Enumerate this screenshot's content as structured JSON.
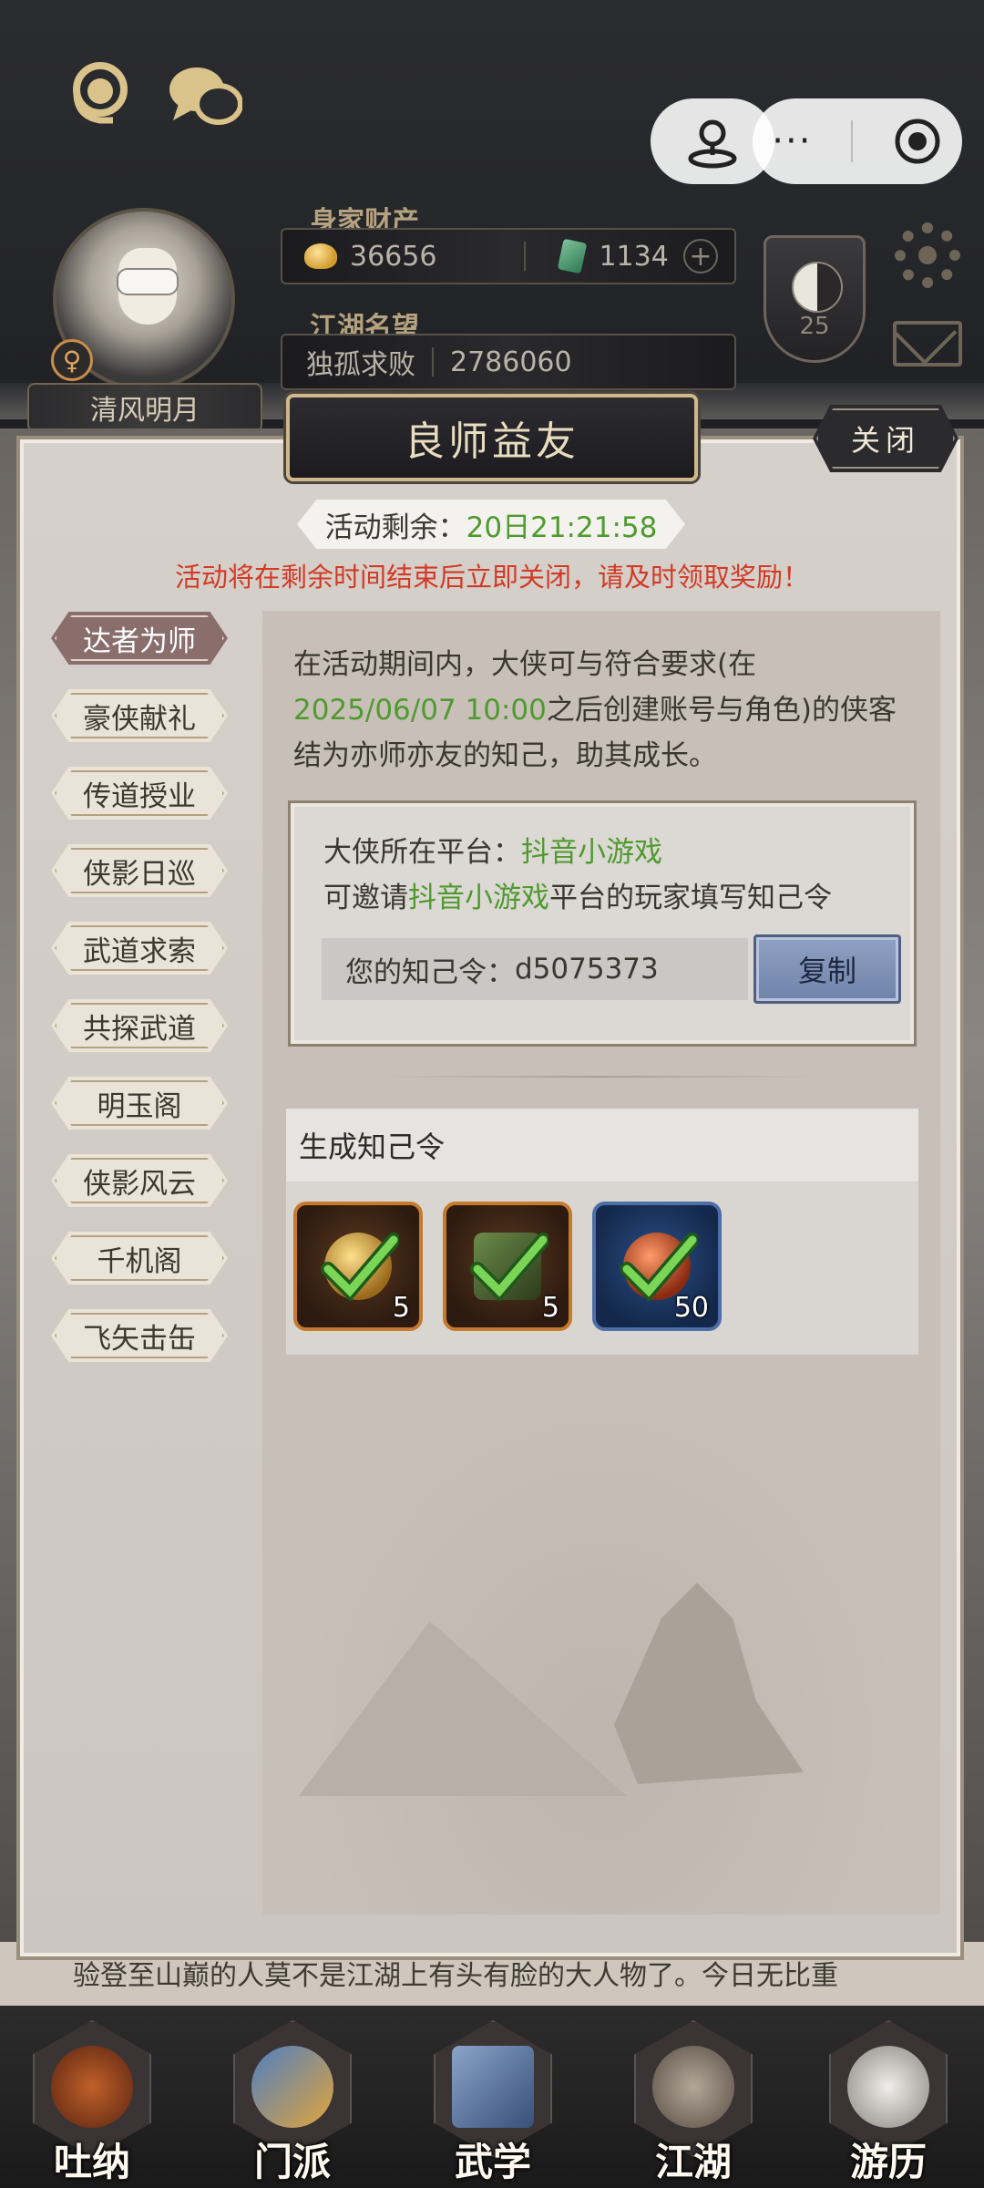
{
  "header": {
    "player_name": "清风明月",
    "gender_symbol": "♀",
    "wealth_label": "身家财产",
    "gold_value": "36656",
    "jade_value": "1134",
    "plus_symbol": "+",
    "fame_label": "江湖名望",
    "fame_title": "独孤求败",
    "fame_value": "2786060",
    "level": "25",
    "more_symbol": "···"
  },
  "modal": {
    "title": "良师益友",
    "close_label": "关闭",
    "timer_label": "活动剩余：",
    "timer_value": "20日21:21:58",
    "warning": "活动将在剩余时间结束后立即关闭，请及时领取奖励！",
    "tabs": [
      {
        "label": "达者为师",
        "active": true
      },
      {
        "label": "豪侠献礼",
        "active": false
      },
      {
        "label": "传道授业",
        "active": false
      },
      {
        "label": "侠影日巡",
        "active": false
      },
      {
        "label": "武道求索",
        "active": false
      },
      {
        "label": "共探武道",
        "active": false
      },
      {
        "label": "明玉阁",
        "active": false
      },
      {
        "label": "侠影风云",
        "active": false
      },
      {
        "label": "千机阁",
        "active": false
      },
      {
        "label": "飞矢击缶",
        "active": false
      }
    ],
    "description": {
      "part1": "在活动期间内，大侠可与符合要求(在",
      "highlight": "2025/06/07 10:00",
      "part2": "之后创建账号与角色)的侠客结为亦师亦友的知己，助其成长。"
    },
    "platform_label": "大侠所在平台：",
    "platform_name": "抖音小游戏",
    "invite_prefix": "可邀请",
    "invite_platform": "抖音小游戏",
    "invite_suffix": "平台的玩家填写知己令",
    "code_label": "您的知己令：",
    "code_value": "d5075373",
    "copy_label": "复制",
    "generate_title": "生成知己令",
    "rewards": [
      {
        "icon": "gold-coin-icon",
        "qty": "5",
        "claimed": true
      },
      {
        "icon": "book-icon",
        "qty": "5",
        "claimed": true
      },
      {
        "icon": "orb-icon",
        "qty": "50",
        "claimed": true
      }
    ]
  },
  "story_text": "验登至山巅的人莫不是江湖上有头有脸的大人物了。今日无比重",
  "bottom_nav": [
    {
      "label": "吐纳"
    },
    {
      "label": "门派"
    },
    {
      "label": "武学"
    },
    {
      "label": "江湖"
    },
    {
      "label": "游历"
    }
  ]
}
